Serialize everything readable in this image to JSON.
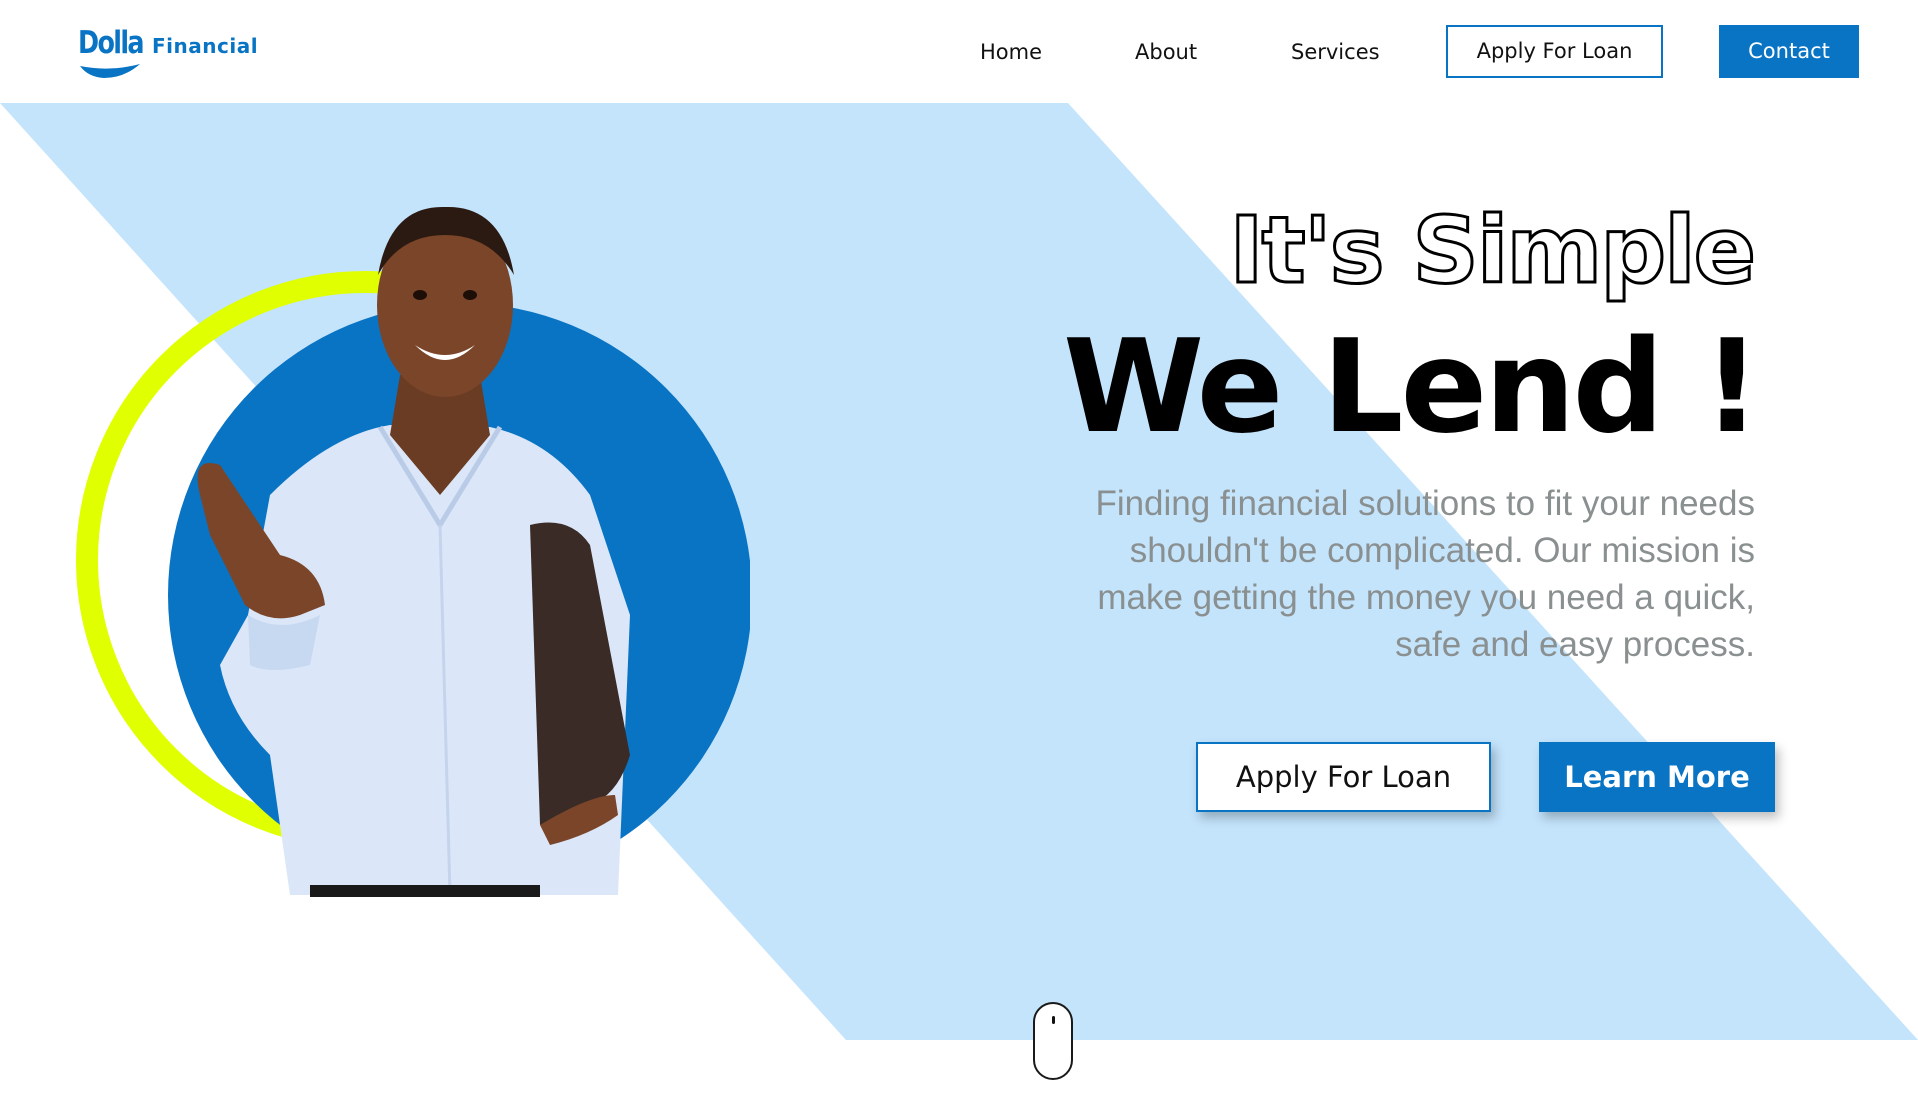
{
  "brand": {
    "name": "Dolla",
    "subtitle": "Financial"
  },
  "nav": {
    "home": "Home",
    "about": "About",
    "services": "Services",
    "apply": "Apply For Loan",
    "contact": "Contact"
  },
  "hero": {
    "headline_outline": "It's Simple",
    "headline_bold": "We Lend !",
    "description": "Finding financial solutions to fit your needs shouldn't be complicated. Our mission is make getting the money you need a quick, safe and easy process.",
    "apply_button": "Apply For Loan",
    "learn_button": "Learn More"
  },
  "colors": {
    "brand_blue": "#0a74c4",
    "light_blue_band": "#c4e4fc",
    "accent_lime": "#e0ff00",
    "body_text_gray": "#8a8f90"
  },
  "icons": {
    "logo": "dolla-logo-icon",
    "scroll": "scroll-mouse-icon"
  }
}
